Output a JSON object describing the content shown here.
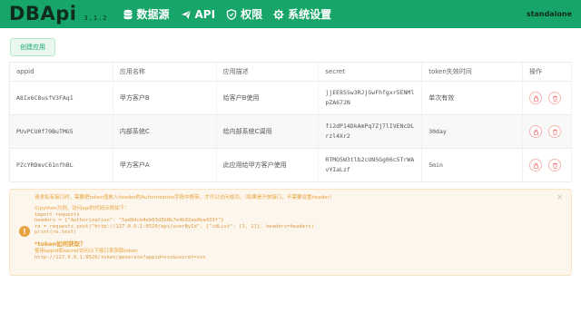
{
  "header": {
    "logo": "DBApi",
    "version": "3.1.2",
    "nav": [
      {
        "label": "数据源",
        "icon": "database-icon"
      },
      {
        "label": "API",
        "icon": "send-icon"
      },
      {
        "label": "权限",
        "icon": "shield-icon"
      },
      {
        "label": "系统设置",
        "icon": "gear-icon"
      }
    ],
    "mode": "standalone"
  },
  "toolbar": {
    "create_label": "创建应用"
  },
  "table": {
    "columns": [
      "appid",
      "应用名称",
      "应用描述",
      "secret",
      "token失效时间",
      "操作"
    ],
    "rows": [
      {
        "appid": "A8Ix6C8usfV3FAq1",
        "name": "甲方客户B",
        "desc": "给客户B使用",
        "secret": "jjEE85Sw3RJjGwFhfgxr5ENMlpZA672N",
        "expire": "单次有效"
      },
      {
        "appid": "PUvPCU0f70BuTMG5",
        "name": "内部系统C",
        "desc": "给内部系统C调用",
        "secret": "fi2dP14DkAmPq7Zj7lIVENcDLrzl4Xr2",
        "expire": "30day"
      },
      {
        "appid": "PZcYRDmvC61nfhBL",
        "name": "甲方客户A",
        "desc": "此应用给甲方客户使用",
        "secret": "RTMO5W3tlb2cUN5Gg06c5TrWAvYIaLzf",
        "expire": "5min"
      }
    ]
  },
  "alert": {
    "line1": "请求私有接口时，需要把token值放入header的Authorization字段中携带，才可以访问成功。（如果是开放接口，不需要设置header）",
    "line2": "以python为例，访问api的代码示例如下：",
    "code": [
      "import requests",
      "headers = {\"Authorization\": \"5ad0dcb4eb03d3b0b7e4b92ae0ba433f\"}",
      "re = requests.post(\"http://127.0.0.1:8520/api/userById\", {\"idList\": [1, 2]}, headers=headers)",
      "print(re.text)"
    ],
    "how_title": "*token如何获取？",
    "how_line": "使用appid和secret访问以下接口来获取token",
    "how_url": "http://127.0.0.1:8520/token/generate?appid=xxx&secret=xxx"
  },
  "colors": {
    "brand": "#17a56a",
    "warning": "#e6a23c",
    "danger": "#f56c6c"
  }
}
